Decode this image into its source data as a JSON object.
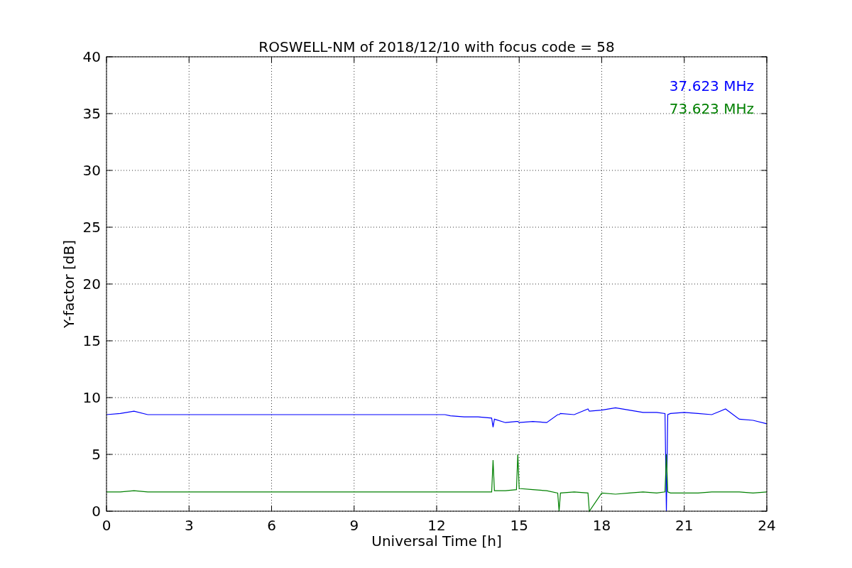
{
  "chart_data": {
    "type": "line",
    "title": "ROSWELL-NM of 2018/12/10 with focus code = 58",
    "xlabel": "Universal Time [h]",
    "ylabel": "Y-factor [dB]",
    "x": [
      0,
      0.5,
      1,
      1.5,
      12.3,
      12.5,
      13,
      13.5,
      14,
      14.05,
      14.1,
      14.5,
      14.9,
      14.95,
      15,
      15.5,
      16,
      16.4,
      16.45,
      16.5,
      17,
      17.5,
      17.55,
      18,
      18.5,
      19,
      19.5,
      20,
      20.3,
      20.35,
      20.4,
      20.5,
      21,
      21.5,
      22,
      22.5,
      23,
      23.5,
      24
    ],
    "series": [
      {
        "name": "37.623 MHz",
        "color": "#0000ff",
        "values": [
          8.5,
          8.6,
          8.8,
          8.5,
          8.5,
          8.4,
          8.3,
          8.3,
          8.2,
          7.4,
          8.1,
          7.8,
          7.9,
          7.9,
          7.8,
          7.9,
          7.8,
          8.5,
          8.5,
          8.6,
          8.5,
          9.0,
          8.8,
          8.9,
          9.1,
          8.9,
          8.7,
          8.7,
          8.6,
          0,
          8.5,
          8.6,
          8.7,
          8.6,
          8.5,
          9.0,
          8.1,
          8.0,
          7.7
        ]
      },
      {
        "name": "73.623 MHz",
        "color": "#008000",
        "values": [
          1.7,
          1.7,
          1.8,
          1.7,
          1.7,
          1.7,
          1.7,
          1.7,
          1.7,
          4.5,
          1.8,
          1.8,
          1.9,
          5.0,
          2.0,
          1.9,
          1.8,
          1.6,
          0,
          1.6,
          1.7,
          1.6,
          0,
          1.6,
          1.5,
          1.6,
          1.7,
          1.6,
          1.7,
          5.0,
          1.7,
          1.6,
          1.6,
          1.6,
          1.7,
          1.7,
          1.7,
          1.6,
          1.7
        ]
      }
    ],
    "xlim": [
      0,
      24
    ],
    "ylim": [
      0,
      40
    ],
    "xticks": [
      0,
      3,
      6,
      9,
      12,
      15,
      18,
      21,
      24
    ],
    "yticks": [
      0,
      5,
      10,
      15,
      20,
      25,
      30,
      35,
      40
    ],
    "grid": true
  }
}
